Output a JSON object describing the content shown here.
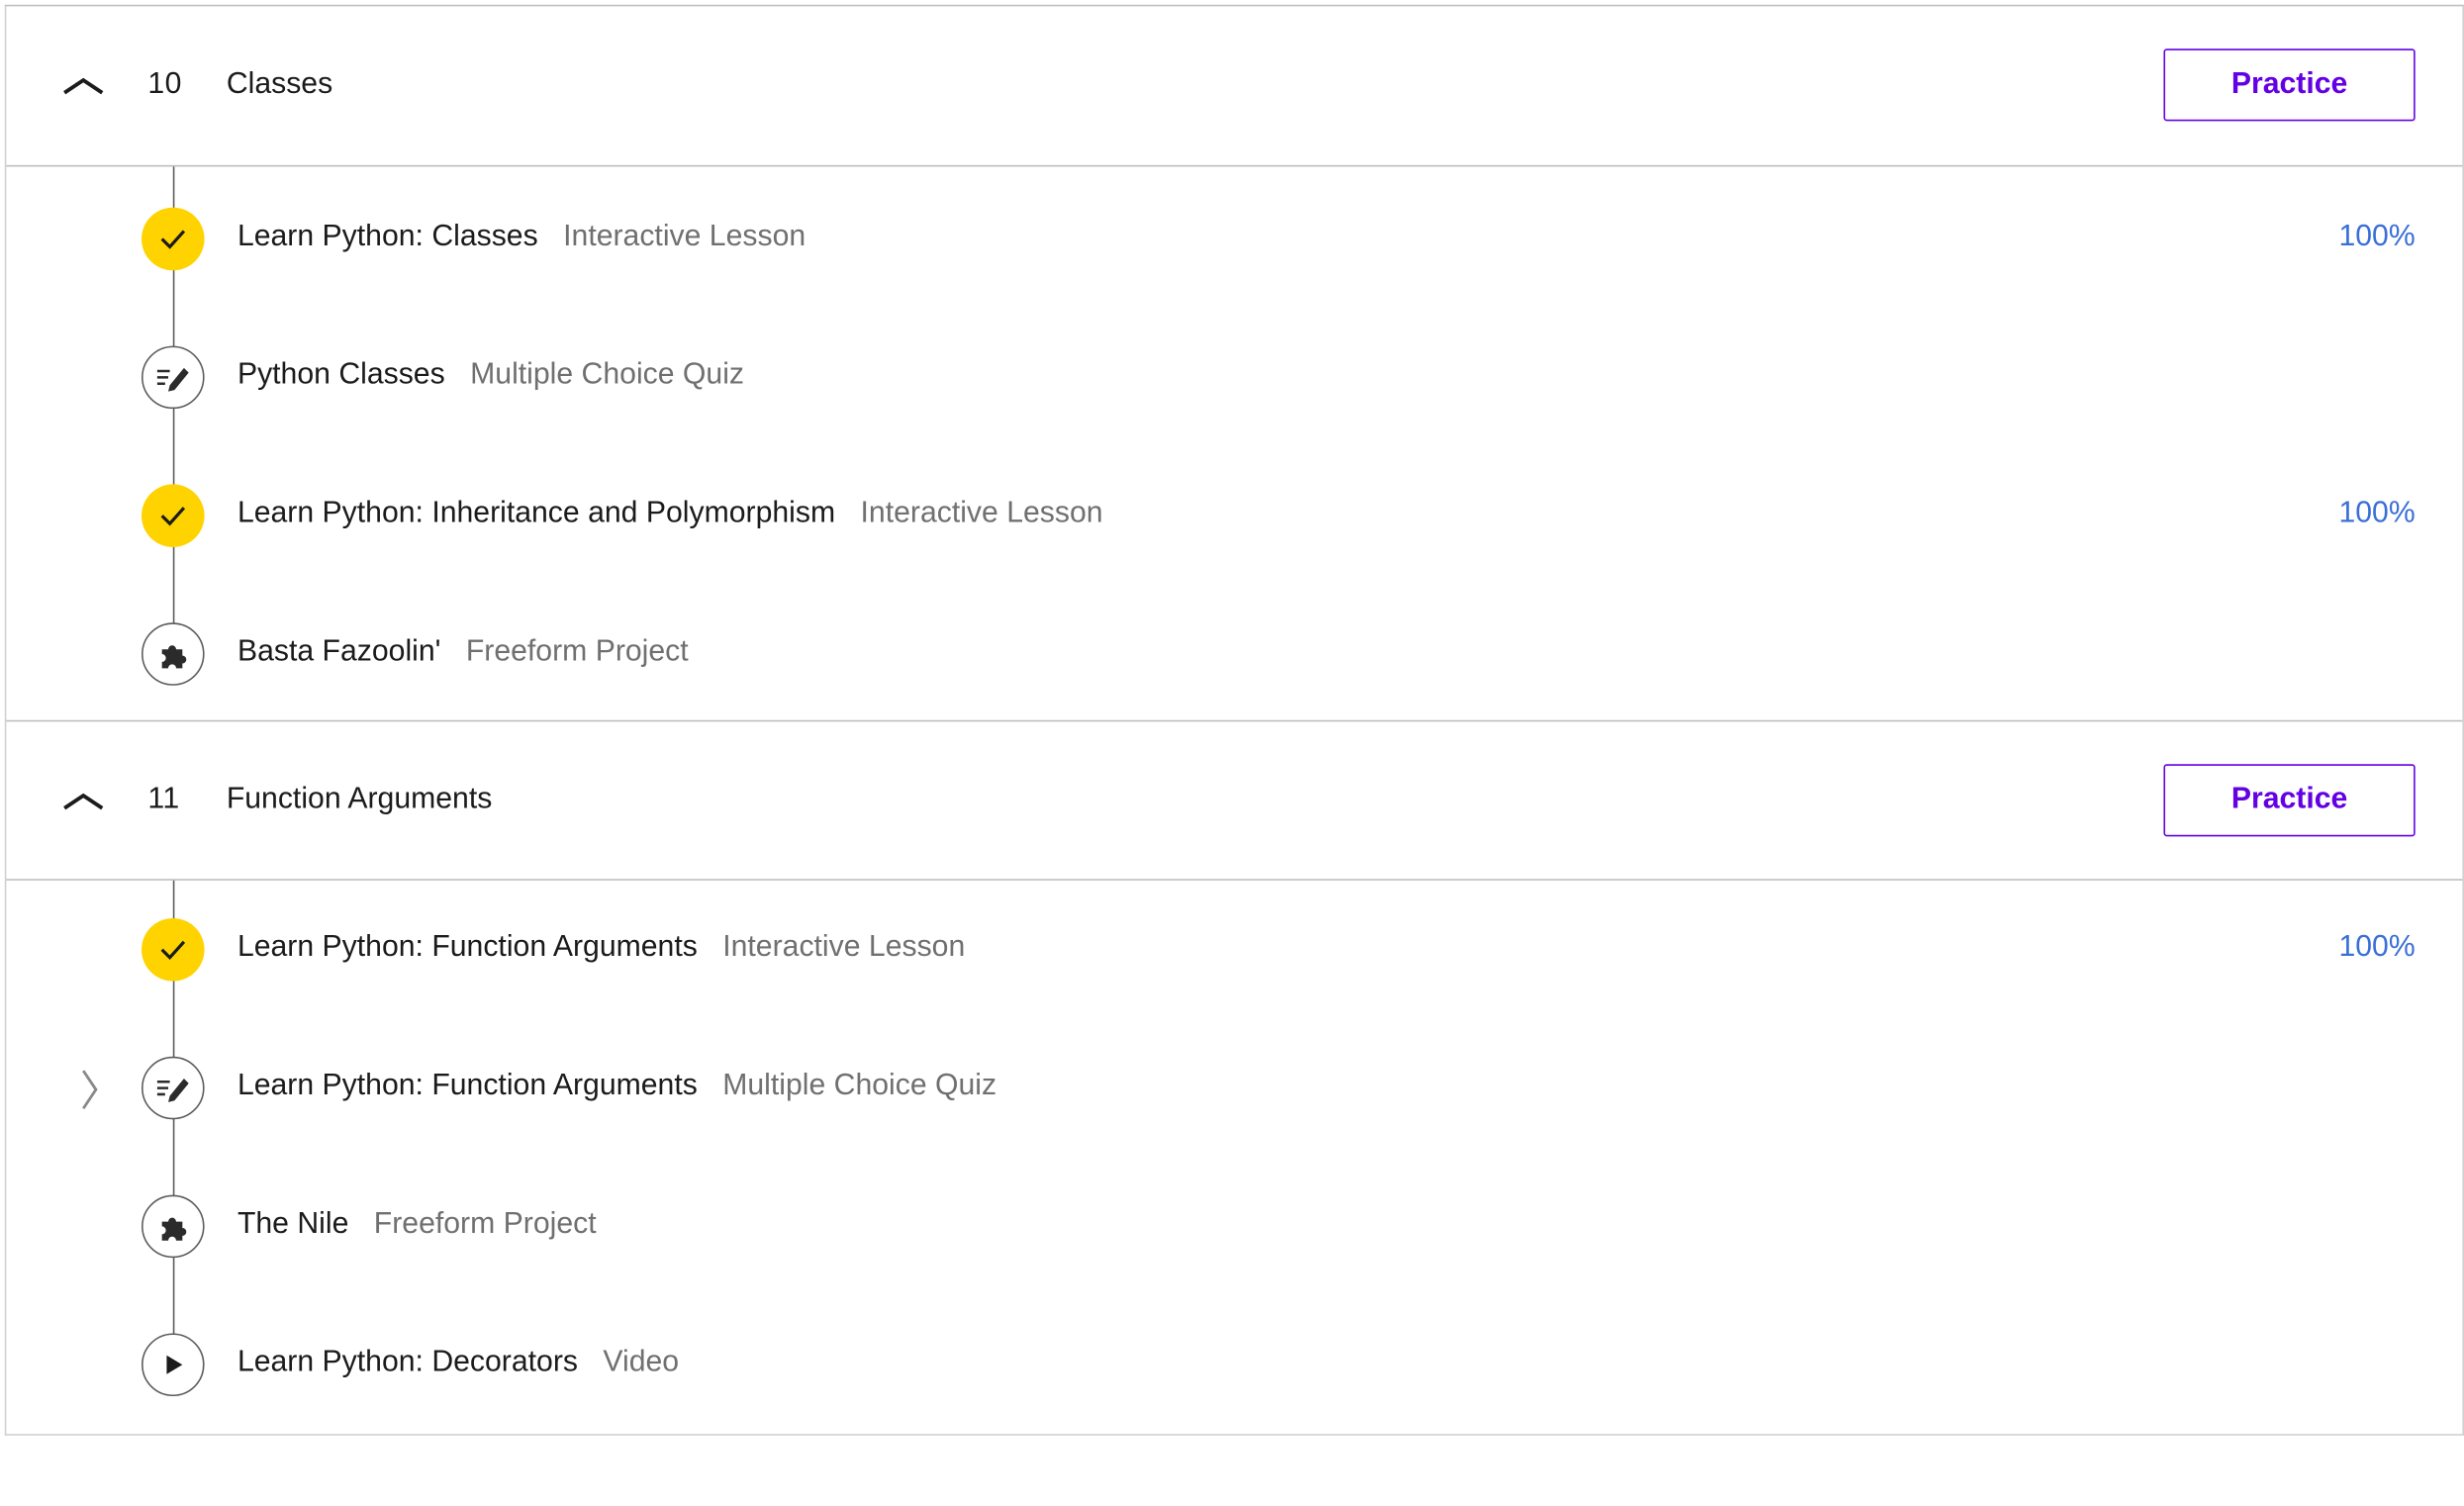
{
  "modules": [
    {
      "number": "10",
      "title": "Classes",
      "practice_label": "Practice",
      "items": [
        {
          "title": "Learn Python: Classes",
          "type": "Interactive Lesson",
          "status": "complete",
          "icon": "check-icon",
          "progress": "100%"
        },
        {
          "title": "Python Classes",
          "type": "Multiple Choice Quiz",
          "status": "open",
          "icon": "pencil-quiz-icon",
          "progress": ""
        },
        {
          "title": "Learn Python: Inheritance and Polymorphism",
          "type": "Interactive Lesson",
          "status": "complete",
          "icon": "check-icon",
          "progress": "100%"
        },
        {
          "title": "Basta Fazoolin'",
          "type": "Freeform Project",
          "status": "open",
          "icon": "puzzle-icon",
          "progress": ""
        }
      ]
    },
    {
      "number": "11",
      "title": "Function Arguments",
      "practice_label": "Practice",
      "items": [
        {
          "title": "Learn Python: Function Arguments",
          "type": "Interactive Lesson",
          "status": "complete",
          "icon": "check-icon",
          "progress": "100%"
        },
        {
          "title": "Learn Python: Function Arguments",
          "type": "Multiple Choice Quiz",
          "status": "open",
          "icon": "pencil-quiz-icon",
          "progress": ""
        },
        {
          "title": "The Nile",
          "type": "Freeform Project",
          "status": "open",
          "icon": "puzzle-icon",
          "progress": ""
        },
        {
          "title": "Learn Python: Decorators",
          "type": "Video",
          "status": "open",
          "icon": "play-icon",
          "progress": ""
        }
      ]
    }
  ],
  "colors": {
    "accent_purple": "#6400e4",
    "complete_yellow": "#ffd300",
    "progress_blue": "#3a6fd8",
    "secondary_text": "#707070"
  }
}
